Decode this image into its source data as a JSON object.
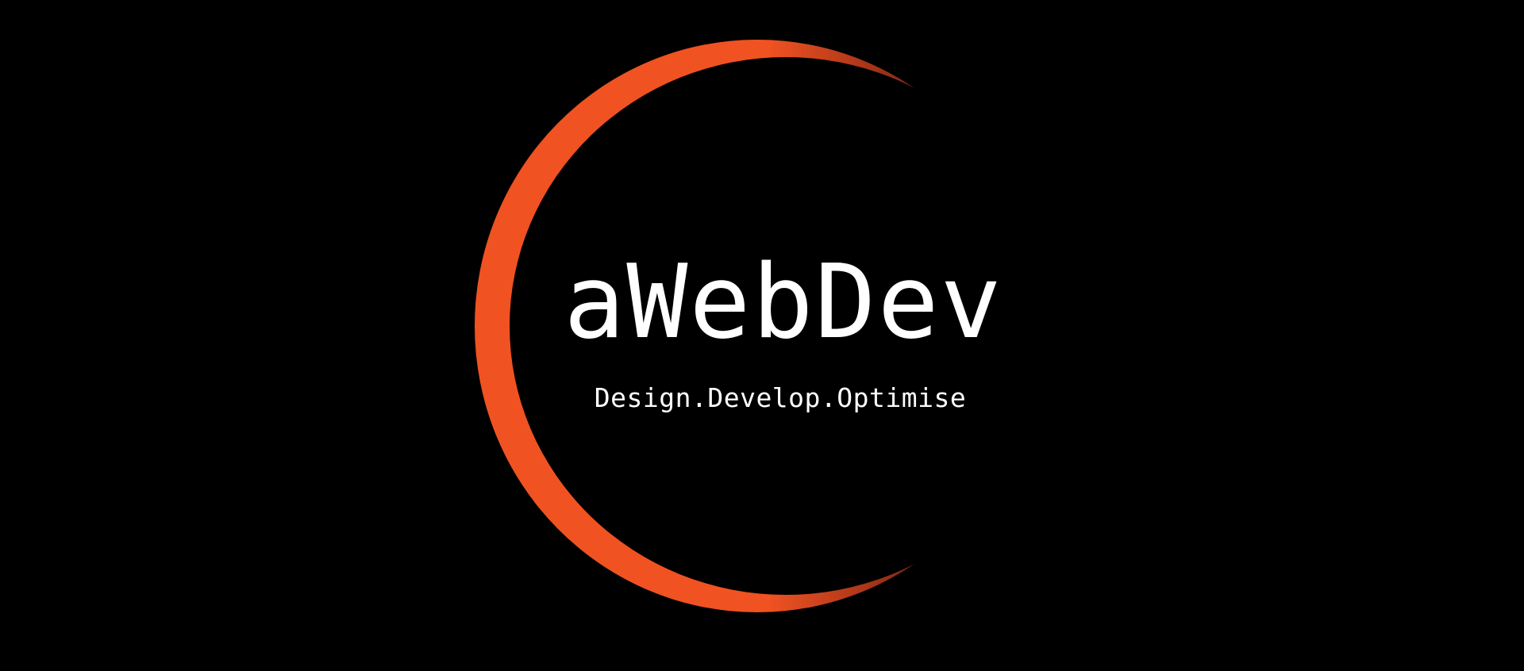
{
  "logo": {
    "name": "aWebDev",
    "tagline": "Design.Develop.Optimise",
    "icon": "crescent-ring-icon"
  },
  "colors": {
    "background": "#000000",
    "accent": "#f05222",
    "text": "#ffffff"
  }
}
